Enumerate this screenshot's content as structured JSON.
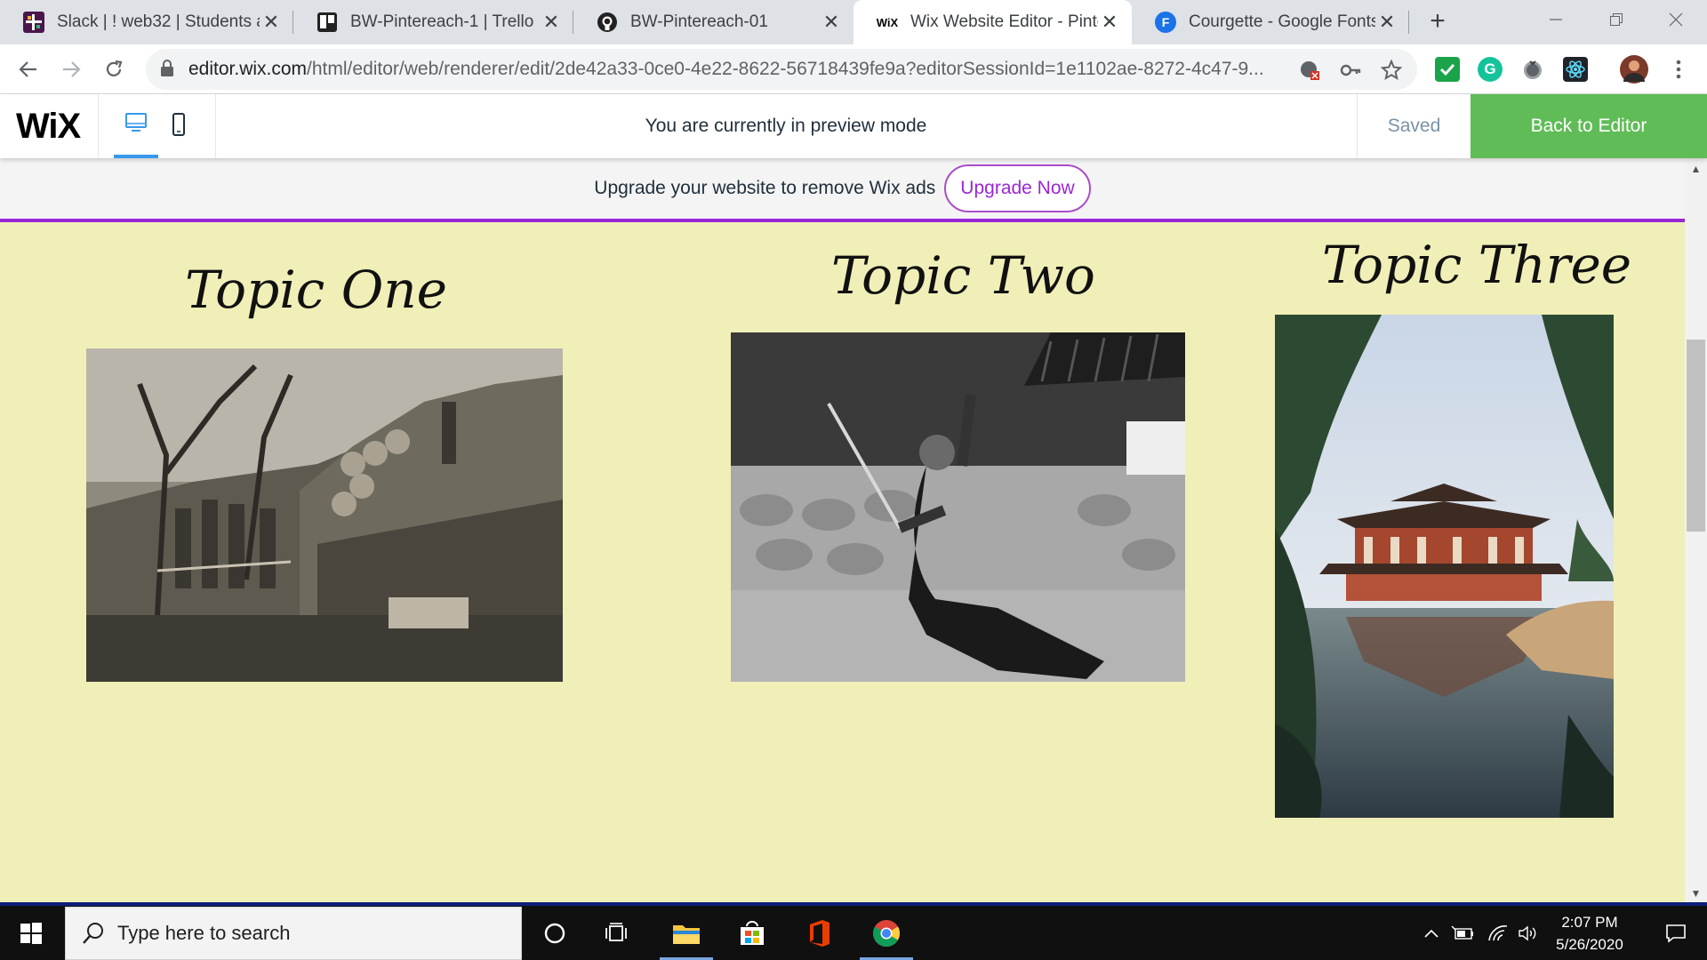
{
  "browser": {
    "tabs": [
      {
        "title": "Slack | ! web32 | Students at",
        "favicon": "slack-icon"
      },
      {
        "title": "BW-Pintereach-1 | Trello",
        "favicon": "trello-icon"
      },
      {
        "title": "BW-Pintereach-01",
        "favicon": "github-icon"
      },
      {
        "title": "Wix Website Editor - Pinter",
        "favicon": "wix-icon",
        "favicon_text": "WiX",
        "active": true
      },
      {
        "title": "Courgette - Google Fonts",
        "favicon": "google-fonts-icon",
        "favicon_text": "F"
      }
    ],
    "new_tab_label": "+",
    "url_host": "editor.wix.com",
    "url_path": "/html/editor/web/renderer/edit/2de42a33-0ce0-4e22-8622-56718439fe9a?editorSessionId=1e1102ae-8272-4c47-9..."
  },
  "wix_header": {
    "logo": "WiX",
    "preview_message": "You are currently in preview mode",
    "saved_label": "Saved",
    "back_button_label": "Back to Editor",
    "accent_color": "#60bc57"
  },
  "ad_banner": {
    "text": "Upgrade your website to remove Wix ads",
    "button_label": "Upgrade Now",
    "accent_color": "#9a27d5"
  },
  "page": {
    "background_color": "#f0efb8",
    "topics": [
      {
        "title": "Topic One",
        "image": "ww1-trench-soldiers-photo"
      },
      {
        "title": "Topic Two",
        "image": "swordswoman-kneeling-photo"
      },
      {
        "title": "Topic Three",
        "image": "japanese-temple-reflection-photo"
      }
    ]
  },
  "taskbar": {
    "search_placeholder": "Type here to search",
    "time": "2:07 PM",
    "date": "5/26/2020"
  }
}
